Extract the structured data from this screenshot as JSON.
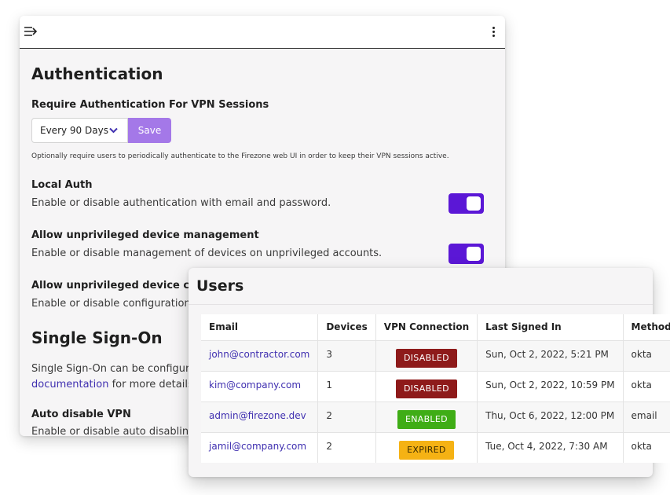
{
  "settings": {
    "authentication_title": "Authentication",
    "require_auth_label": "Require Authentication For VPN Sessions",
    "interval_select_value": "Every 90 Days",
    "save_label": "Save",
    "require_auth_help": "Optionally require users to periodically authenticate to the Firezone web UI in order to keep their VPN sessions active.",
    "local_auth": {
      "title": "Local Auth",
      "description": "Enable or disable authentication with email and password.",
      "enabled": true
    },
    "device_management": {
      "title": "Allow unprivileged device management",
      "description": "Enable or disable management of devices on unprivileged accounts.",
      "enabled": true
    },
    "device_config": {
      "title": "Allow unprivileged device configur",
      "description": "Enable or disable configuration of"
    },
    "sso_title": "Single Sign-On",
    "sso_text_line1": "Single Sign-On can be configured i",
    "sso_doc_link": "documentation",
    "sso_text_line2_rest": " for more details.",
    "auto_disable": {
      "title": "Auto disable VPN",
      "description": "Enable or disable auto disabling V"
    }
  },
  "users": {
    "title": "Users",
    "columns": [
      "Email",
      "Devices",
      "VPN Connection",
      "Last Signed In",
      "Method"
    ],
    "rows": [
      {
        "email": "john@contractor.com",
        "devices": "3",
        "vpn": "DISABLED",
        "vpn_status": "disabled",
        "last_signed_in": "Sun, Oct 2, 2022, 5:21 PM",
        "method": "okta"
      },
      {
        "email": "kim@company.com",
        "devices": "1",
        "vpn": "DISABLED",
        "vpn_status": "disabled",
        "last_signed_in": "Sun, Oct 2, 2022, 10:59 PM",
        "method": "okta"
      },
      {
        "email": "admin@firezone.dev",
        "devices": "2",
        "vpn": "ENABLED",
        "vpn_status": "enabled",
        "last_signed_in": "Thu, Oct 6, 2022, 12:00 PM",
        "method": "email"
      },
      {
        "email": "jamil@company.com",
        "devices": "2",
        "vpn": "EXPIRED",
        "vpn_status": "expired",
        "last_signed_in": "Tue, Oct 4, 2022, 7:30 AM",
        "method": "okta"
      }
    ]
  },
  "colors": {
    "accent": "#5b17d6",
    "save_button": "#a478e8",
    "link": "#3f2fb0",
    "badge_disabled": "#8e1a1a",
    "badge_enabled": "#3fad16",
    "badge_expired": "#f5b214"
  },
  "icons": {
    "menu": "menu-collapse-icon",
    "more": "kebab-menu-icon",
    "select": "chevron-down-icon"
  }
}
